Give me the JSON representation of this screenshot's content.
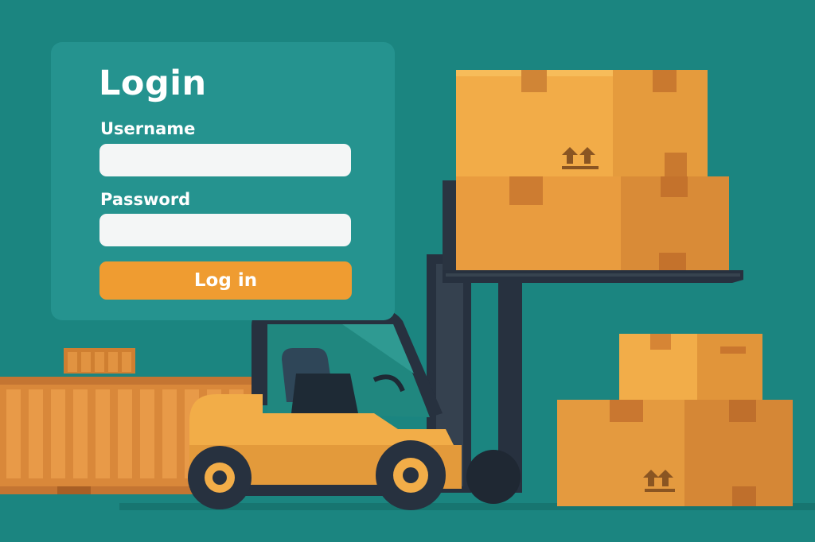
{
  "login": {
    "title": "Login",
    "username_label": "Username",
    "username_value": "",
    "password_label": "Password",
    "password_value": "",
    "submit_label": "Log in"
  },
  "colors": {
    "background": "#1b8580",
    "panel": "#25938f",
    "accent": "#ef9c31",
    "input_bg": "#f4f6f6"
  },
  "illustration": {
    "forklift": "forklift-illustration",
    "boxes": "cardboard-boxes",
    "container": "shipping-container",
    "box_symbol": "this-way-up-arrows-icon"
  }
}
